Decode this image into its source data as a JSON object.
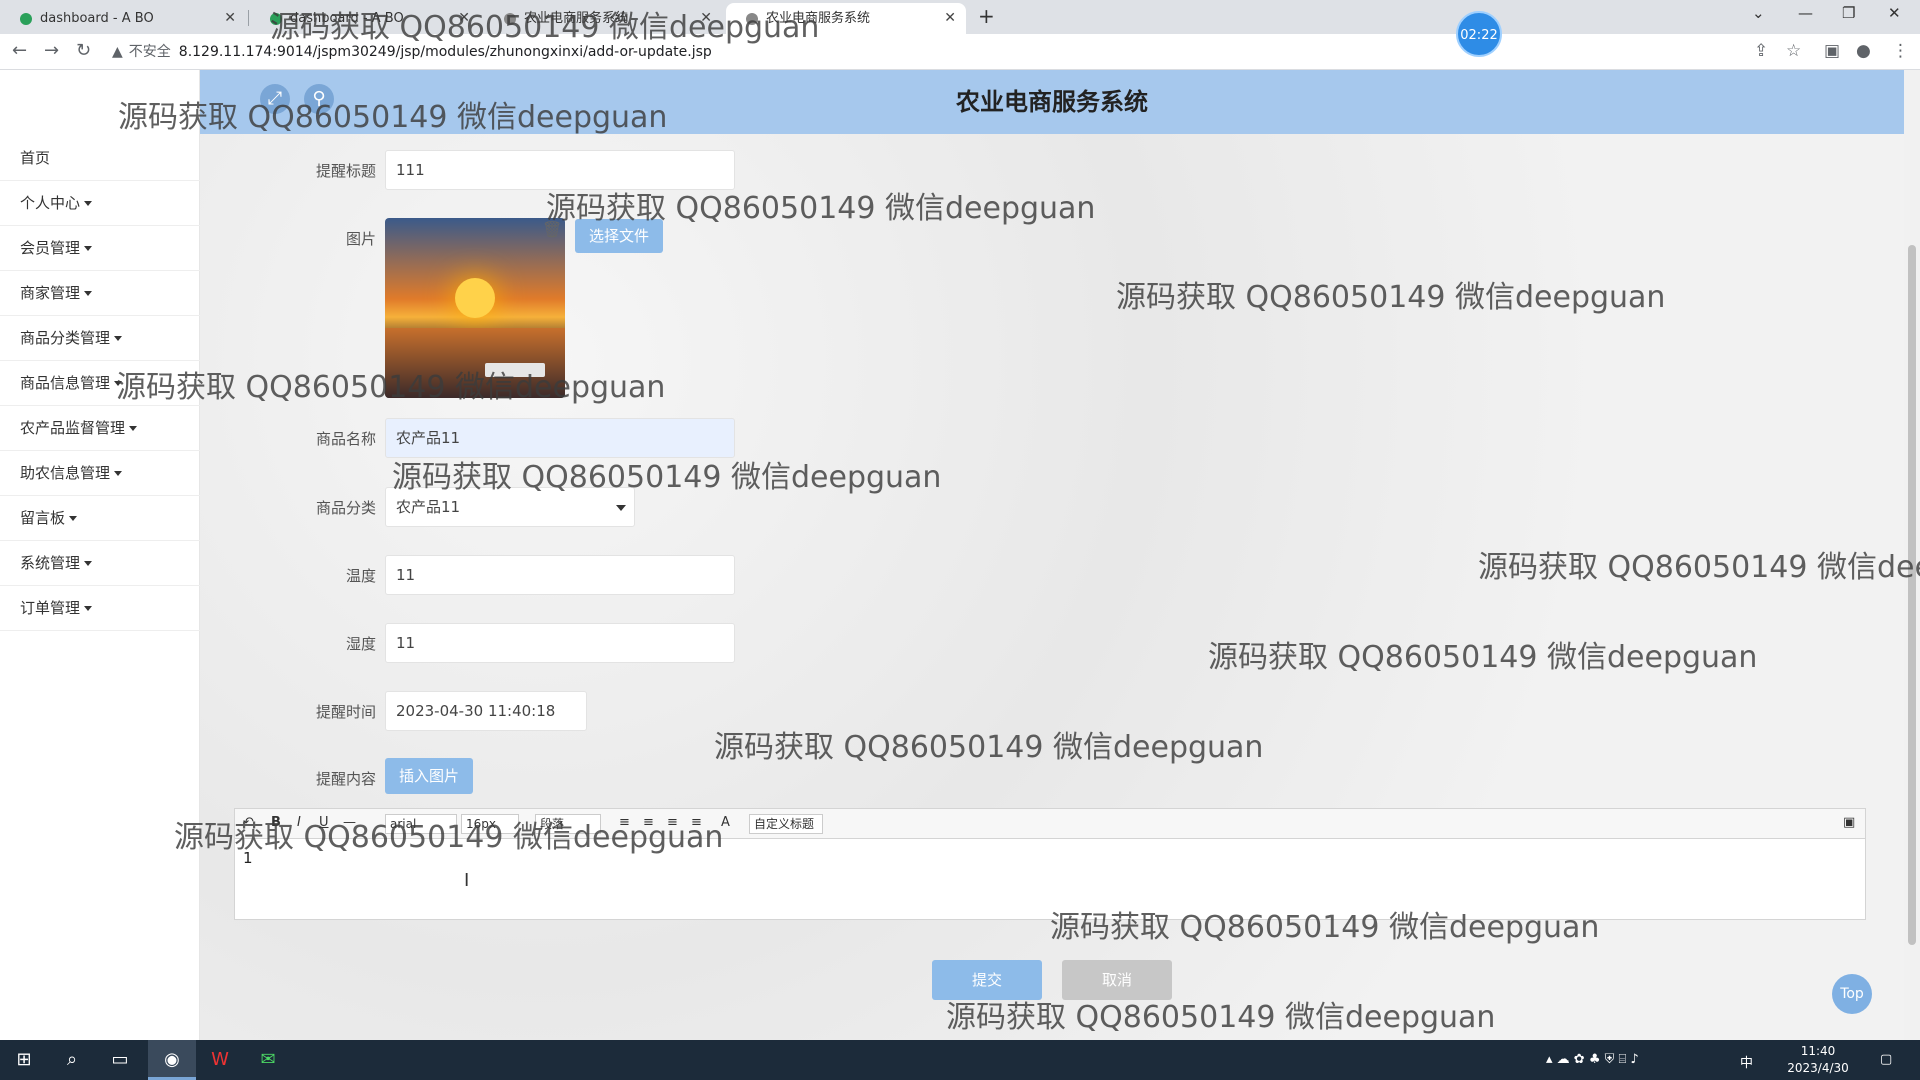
{
  "browser": {
    "tabs": [
      {
        "title": "dashboard - A BO"
      },
      {
        "title": "dashboard - A BO"
      },
      {
        "title": "农业电商服务系统"
      },
      {
        "title": "农业电商服务系统"
      }
    ],
    "timer": "02:22",
    "insecure_label": "不安全",
    "url": "8.129.11.174:9014/jspm30249/jsp/modules/zhunongxinxi/add-or-update.jsp"
  },
  "header": {
    "title": "农业电商服务系统"
  },
  "sidebar": {
    "items": [
      {
        "label": "首页",
        "dropdown": false
      },
      {
        "label": "个人中心",
        "dropdown": true
      },
      {
        "label": "会员管理",
        "dropdown": true
      },
      {
        "label": "商家管理",
        "dropdown": true
      },
      {
        "label": "商品分类管理",
        "dropdown": true
      },
      {
        "label": "商品信息管理",
        "dropdown": true
      },
      {
        "label": "农产品监督管理",
        "dropdown": true
      },
      {
        "label": "助农信息管理",
        "dropdown": true
      },
      {
        "label": "留言板",
        "dropdown": true
      },
      {
        "label": "系统管理",
        "dropdown": true
      },
      {
        "label": "订单管理",
        "dropdown": true
      }
    ]
  },
  "form": {
    "title_label": "提醒标题",
    "title_value": "111",
    "image_label": "图片",
    "choose_file": "选择文件",
    "product_name_label": "商品名称",
    "product_name_value": "农产品11",
    "category_label": "商品分类",
    "category_value": "农产品11",
    "temperature_label": "温度",
    "temperature_value": "11",
    "humidity_label": "湿度",
    "humidity_value": "11",
    "remind_time_label": "提醒时间",
    "remind_time_value": "2023-04-30 11:40:18",
    "content_label": "提醒内容",
    "insert_image": "插入图片",
    "submit": "提交",
    "cancel": "取消"
  },
  "editor": {
    "font_value": "arial",
    "size_value": "16px",
    "paragraph_value": "段落",
    "custom_title": "自定义标题",
    "content": "1"
  },
  "top_button": "Top",
  "watermark_text": "源码获取 QQ86050149 微信deepguan",
  "taskbar": {
    "time": "11:40",
    "date": "2023/4/30",
    "ime": "中"
  }
}
